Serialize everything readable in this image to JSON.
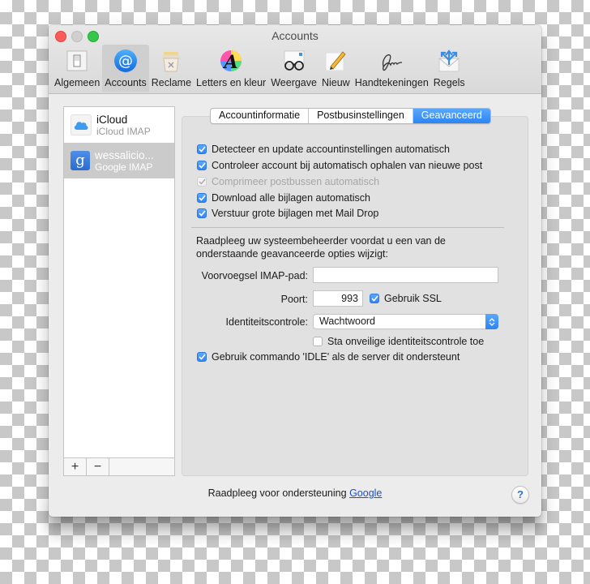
{
  "window": {
    "title": "Accounts"
  },
  "toolbar": {
    "items": [
      {
        "label": "Algemeen",
        "icon": "switch-icon"
      },
      {
        "label": "Accounts",
        "icon": "at-sign-icon",
        "active": true
      },
      {
        "label": "Reclame",
        "icon": "trash-bin-icon"
      },
      {
        "label": "Letters en kleur",
        "icon": "font-color-icon"
      },
      {
        "label": "Weergave",
        "icon": "glasses-icon"
      },
      {
        "label": "Nieuw",
        "icon": "pencil-icon"
      },
      {
        "label": "Handtekeningen",
        "icon": "signature-icon"
      },
      {
        "label": "Regels",
        "icon": "rules-envelope-icon"
      }
    ]
  },
  "accounts": [
    {
      "name": "iCloud",
      "type": "iCloud IMAP",
      "icon": "icloud-icon",
      "selected": false
    },
    {
      "name": "wessalicio...",
      "type": "Google IMAP",
      "icon": "google-icon",
      "selected": true
    }
  ],
  "list_footer": {
    "add": "+",
    "remove": "−"
  },
  "tabs": [
    {
      "label": "Accountinformatie",
      "active": false
    },
    {
      "label": "Postbusinstellingen",
      "active": false
    },
    {
      "label": "Geavanceerd",
      "active": true
    }
  ],
  "options": [
    {
      "label": "Detecteer en update accountinstellingen automatisch",
      "checked": true,
      "disabled": false
    },
    {
      "label": "Controleer account bij automatisch ophalen van nieuwe post",
      "checked": true,
      "disabled": false
    },
    {
      "label": "Comprimeer postbussen automatisch",
      "checked": true,
      "disabled": true
    },
    {
      "label": "Download alle bijlagen automatisch",
      "checked": true,
      "disabled": false
    },
    {
      "label": "Verstuur grote bijlagen met Mail Drop",
      "checked": true,
      "disabled": false
    }
  ],
  "advanced": {
    "note": "Raadpleeg uw systeembeheerder voordat u een van de onderstaande geavanceerde opties wijzigt:",
    "imap_prefix_label": "Voorvoegsel IMAP-pad:",
    "imap_prefix_value": "",
    "port_label": "Poort:",
    "port_value": "993",
    "ssl_label": "Gebruik SSL",
    "ssl_checked": true,
    "auth_label": "Identiteitscontrole:",
    "auth_value": "Wachtwoord",
    "insecure_auth_label": "Sta onveilige identiteitscontrole toe",
    "insecure_auth_checked": false,
    "idle_label": "Gebruik commando 'IDLE' als de server dit ondersteunt",
    "idle_checked": true
  },
  "footer": {
    "support_text": "Raadpleeg voor ondersteuning",
    "support_link": "Google",
    "help": "?"
  },
  "colors": {
    "accent": "#2c84f5",
    "link": "#1a4fcc",
    "close": "#fc5b57",
    "maximize": "#35c748"
  }
}
